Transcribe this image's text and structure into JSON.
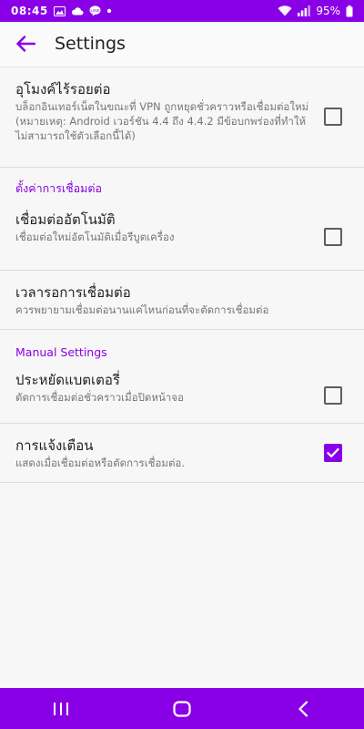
{
  "status_bar": {
    "time": "08:45",
    "battery": "95%",
    "icons": [
      "image-icon",
      "cloud-icon",
      "line-chat-icon",
      "dot-icon",
      "wifi-icon",
      "signal-icon",
      "battery-icon"
    ]
  },
  "app_bar": {
    "title": "Settings",
    "back_icon": "arrow-back-icon"
  },
  "preferences": [
    {
      "title": "อุโมงค์ไร้รอยต่อ",
      "summary": "บล็อกอินเทอร์เน็ตในขณะที่ VPN ถูกหยุดชั่วคราวหรือเชื่อมต่อใหม่ (หมายเหตุ: Android เวอร์ชัน 4.4 ถึง 4.4.2 มีข้อบกพร่องที่ทำให้ไม่สามารถใช้ตัวเลือกนี้ได้)",
      "checked": false
    }
  ],
  "sections": [
    {
      "header": "ตั้งค่าการเชื่อมต่อ",
      "items": [
        {
          "title": "เชื่อมต่ออัตโนมัติ",
          "summary": "เชื่อมต่อใหม่อัตโนมัติเมื่อรีบูตเครื่อง",
          "checked": false
        },
        {
          "title": "เวลารอการเชื่อมต่อ",
          "summary": "ควรพยายามเชื่อมต่อนานแค่ไหนก่อนที่จะตัดการเชื่อมต่อ"
        }
      ]
    },
    {
      "header": "Manual Settings",
      "items": [
        {
          "title": "ประหยัดแบตเตอรี่",
          "summary": "ตัดการเชื่อมต่อชั่วคราวเมื่อปิดหน้าจอ",
          "checked": false
        },
        {
          "title": "การแจ้งเตือน",
          "summary": "แสดงเมื่อเชื่อมต่อหรือตัดการเชื่อมต่อ.",
          "checked": true
        }
      ]
    }
  ],
  "nav_bar": {
    "buttons": [
      "recent-apps-icon",
      "home-icon",
      "back-icon"
    ]
  },
  "colors": {
    "accent": "#8a00e6",
    "background": "#f7f7f7",
    "divider": "#dcdcdc"
  }
}
